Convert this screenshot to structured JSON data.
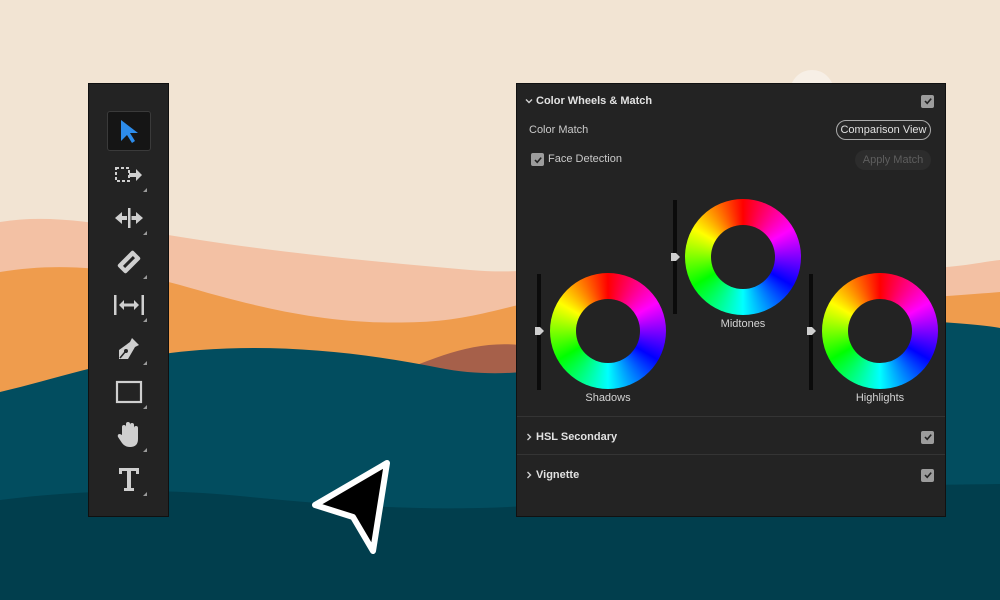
{
  "colors": {
    "sky": "#f2e4d3",
    "dune_light": "#f3c1a4",
    "dune_orange": "#ef9c4d",
    "dune_rust": "#a6604a",
    "sea_teal": "#024d5f",
    "sea_dark": "#013e4d",
    "panel_bg": "#232323",
    "accent_blue": "#2d8ceb"
  },
  "toolbar": {
    "tools": [
      {
        "name": "selection-tool",
        "icon": "arrow-icon",
        "active": true
      },
      {
        "name": "track-select-tool",
        "icon": "track-select-icon"
      },
      {
        "name": "ripple-edit-tool",
        "icon": "ripple-edit-icon"
      },
      {
        "name": "razor-tool",
        "icon": "razor-icon"
      },
      {
        "name": "slip-tool",
        "icon": "slip-icon"
      },
      {
        "name": "pen-tool",
        "icon": "pen-icon"
      },
      {
        "name": "rectangle-tool",
        "icon": "rectangle-icon"
      },
      {
        "name": "hand-tool",
        "icon": "hand-icon"
      },
      {
        "name": "type-tool",
        "icon": "type-icon"
      }
    ]
  },
  "panel": {
    "color_wheels": {
      "title": "Color Wheels & Match",
      "enabled": true,
      "color_match_label": "Color Match",
      "comparison_view_label": "Comparison View",
      "face_detection_label": "Face Detection",
      "face_detection_checked": true,
      "apply_match_label": "Apply Match",
      "wheels": {
        "shadows": {
          "label": "Shadows",
          "level": 0.5
        },
        "midtones": {
          "label": "Midtones",
          "level": 0.5
        },
        "highlights": {
          "label": "Highlights",
          "level": 0.5
        }
      }
    },
    "hsl_secondary": {
      "title": "HSL Secondary",
      "enabled": true
    },
    "vignette": {
      "title": "Vignette",
      "enabled": true
    }
  }
}
